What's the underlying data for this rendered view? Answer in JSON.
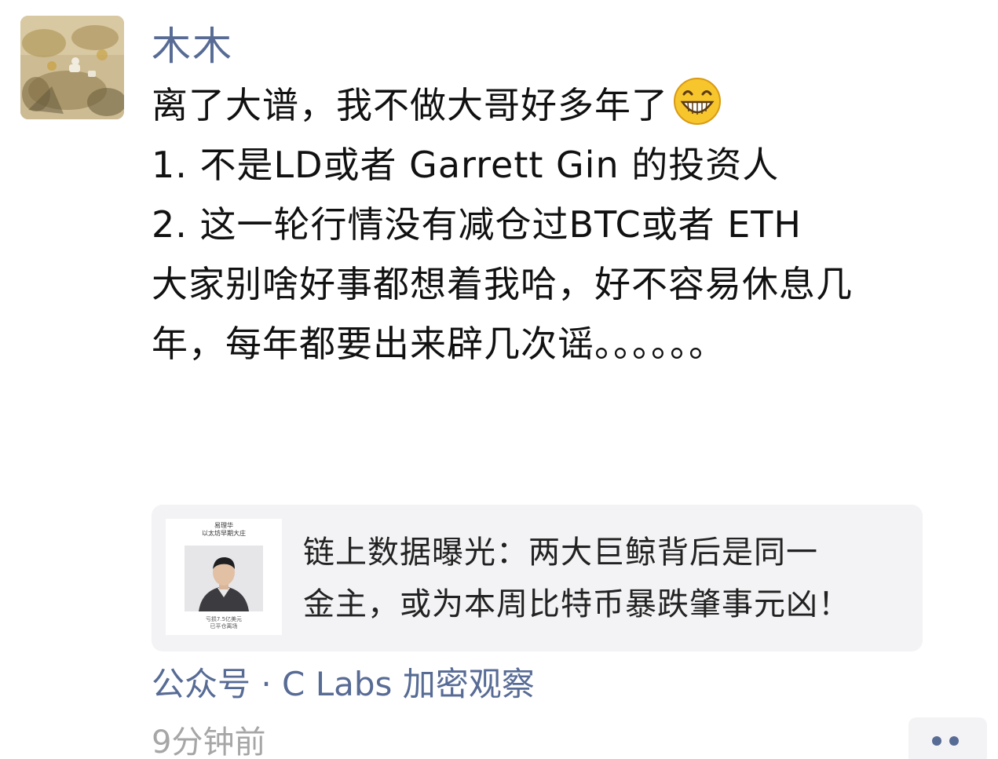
{
  "post": {
    "author": "木木",
    "lines": [
      "离了大谱，我不做大哥好多年了",
      "1. 不是LD或者 Garrett Gin 的投资人",
      "2. 这一轮行情没有减仓过BTC或者 ETH",
      "大家别啥好事都想着我哈，好不容易休息几",
      "年，每年都要出来辟几次谣。。。。。。"
    ],
    "emoji": "grinning-face"
  },
  "link_card": {
    "title_lines": [
      "链上数据曝光：两大巨鲸背后是同一",
      "金主，或为本周比特币暴跌肇事元凶！"
    ],
    "thumbnail": {
      "title_lines": [
        "易理华",
        "以太坊早期大庄"
      ],
      "caption_lines": [
        "亏损7.5亿美元",
        "已平仓离场"
      ]
    }
  },
  "source": "公众号 · C Labs 加密观察",
  "timestamp": "9分钟前",
  "colors": {
    "link_blue": "#576b95",
    "card_bg": "#f3f3f5",
    "timestamp_gray": "#a6a6a6"
  }
}
